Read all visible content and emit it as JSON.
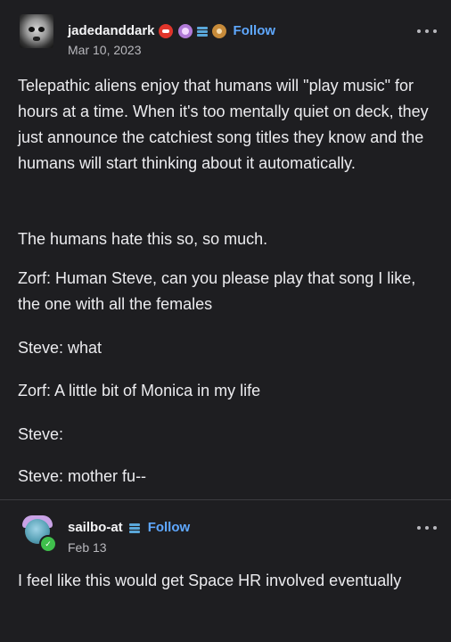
{
  "post": {
    "username": "jadedanddark",
    "follow_label": "Follow",
    "date": "Mar 10, 2023",
    "paragraphs": [
      "Telepathic aliens enjoy that humans will \"play music\" for hours at a time. When it's too mentally quiet on deck, they just announce the catchiest song titles they know and the humans will start thinking about it automatically.",
      "The humans hate this so, so much.",
      "Zorf: Human Steve, can you please play that song I like, the one with all the females",
      "Steve: what",
      "Zorf: A little bit of Monica in my life",
      "Steve:",
      "Steve: mother fu--"
    ]
  },
  "reply": {
    "username": "sailbo-at",
    "follow_label": "Follow",
    "date": "Feb 13",
    "paragraphs": [
      "I feel like this would get Space HR involved eventually"
    ]
  },
  "colors": {
    "background": "#1e1e21",
    "text": "#ececef",
    "follow": "#5fa8ff",
    "muted": "#b8b8bd"
  }
}
